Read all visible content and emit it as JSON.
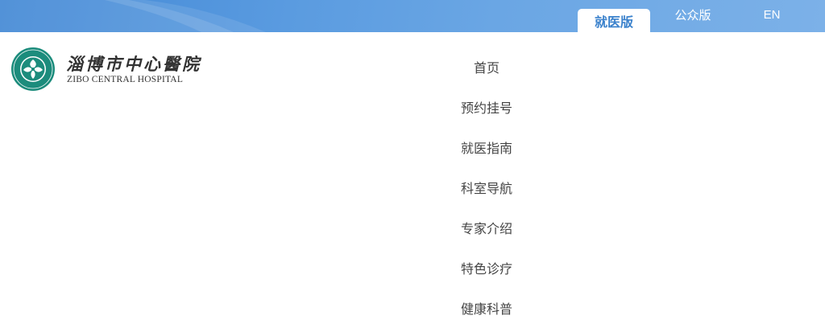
{
  "header": {
    "tabs": [
      {
        "label": "就医版",
        "active": true
      },
      {
        "label": "公众版",
        "active": false
      },
      {
        "label": "EN",
        "active": false
      }
    ]
  },
  "logo": {
    "name_cn": "淄博市中心醫院",
    "name_en": "ZIBO CENTRAL HOSPITAL",
    "emblem_icon": "hospital-emblem-icon"
  },
  "nav": {
    "items": [
      {
        "label": "首页"
      },
      {
        "label": "预约挂号"
      },
      {
        "label": "就医指南"
      },
      {
        "label": "科室导航"
      },
      {
        "label": "专家介绍"
      },
      {
        "label": "特色诊疗"
      },
      {
        "label": "健康科普"
      }
    ]
  },
  "colors": {
    "topbar_start": "#3f86d4",
    "topbar_end": "#7cb1e8",
    "active_tab_text": "#3b82cc",
    "emblem_green": "#1c8c7c",
    "nav_text": "#444444"
  }
}
